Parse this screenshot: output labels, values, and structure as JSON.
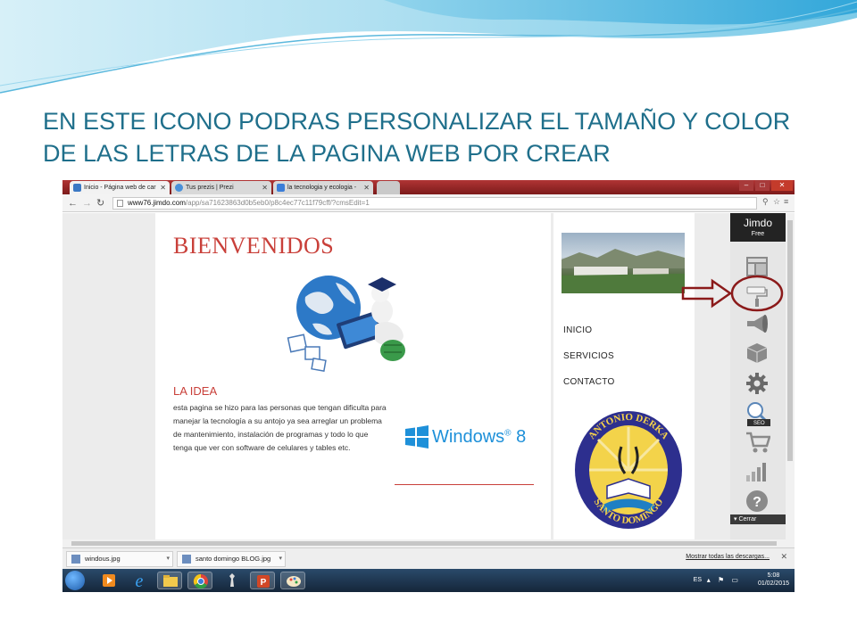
{
  "slide": {
    "title": "EN ESTE ICONO PODRAS PERSONALIZAR EL TAMAÑO Y COLOR DE LAS LETRAS DE LA PAGINA WEB POR CREAR"
  },
  "browser": {
    "tabs": [
      {
        "label": "Inicio - Página web de car",
        "favicon_color": "#3a78c4"
      },
      {
        "label": "Tus prezis | Prezi",
        "favicon_color": "#4a90d9"
      },
      {
        "label": "la tecnologia y ecologia -",
        "favicon_color": "#3b7dd8"
      }
    ],
    "url_host": "www76.jimdo.com",
    "url_path": "/app/sa71623863d0b5eb0/p8c4ec77c11f79cff/?cmsEdit=1"
  },
  "page": {
    "welcome": "BIENVENIDOS",
    "idea_title": "LA IDEA",
    "idea_text": "esta pagina se hizo para las personas que tengan dificulta para manejar la tecnología a su antojo ya sea arreglar un problema de mantenimiento, instalación de programas y todo lo que tenga que ver con software de celulares y tables etc.",
    "windows_label": "Windows",
    "windows_version": "8",
    "menu": [
      "INICIO",
      "SERVICIOS",
      "CONTACTO"
    ],
    "emblem_top": "ANTONIO DERKA",
    "emblem_bottom": "SANTO DOMINGO"
  },
  "jimdo": {
    "logo": "Jimdo",
    "plan": "Free",
    "seo_label": "SEO",
    "close_label": "Cerrar",
    "buttons": [
      "layout",
      "style",
      "marketing",
      "modules",
      "settings",
      "seo",
      "store",
      "statistics",
      "help"
    ]
  },
  "downloads": {
    "items": [
      "windous.jpg",
      "santo domingo BLOG.jpg"
    ],
    "show_all": "Mostrar todas las descargas..."
  },
  "taskbar": {
    "lang": "ES",
    "time": "5:08",
    "date": "01/02/2015"
  },
  "colors": {
    "title": "#1f6f8b",
    "brand_red": "#c9403a",
    "windows_blue": "#1e90d9",
    "annotation": "#8b1a1a"
  }
}
